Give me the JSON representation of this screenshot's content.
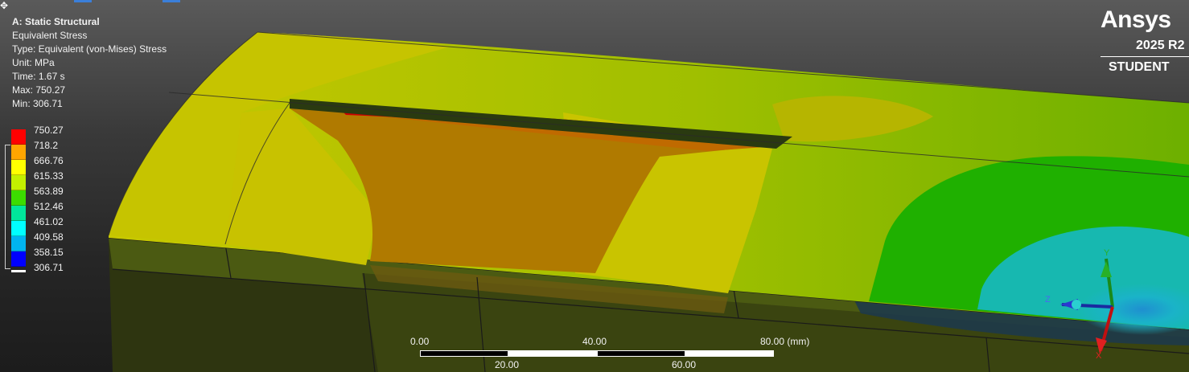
{
  "info": {
    "title": "A: Static Structural",
    "result": "Equivalent Stress",
    "type": "Type: Equivalent (von-Mises) Stress",
    "unit": "Unit: MPa",
    "time": "Time: 1.67 s",
    "max": "Max: 750.27",
    "min": "Min: 306.71"
  },
  "legend": {
    "values": [
      "750.27",
      "718.2",
      "666.76",
      "615.33",
      "563.89",
      "512.46",
      "461.02",
      "409.58",
      "358.15",
      "306.71"
    ],
    "colors": [
      "#ff0000",
      "#ffa500",
      "#ffff00",
      "#c3f000",
      "#3cdc00",
      "#00e69b",
      "#00ffff",
      "#00b4f0",
      "#0000ff"
    ]
  },
  "logo": {
    "brand": "Ansys",
    "version": "2025 R2",
    "edition": "STUDENT"
  },
  "scale_bar": {
    "top_labels": [
      "0.00",
      "40.00",
      "80.00 (mm)"
    ],
    "bottom_labels": [
      "20.00",
      "60.00"
    ]
  },
  "triad": {
    "x": "X",
    "y": "Y",
    "z": "Z"
  }
}
